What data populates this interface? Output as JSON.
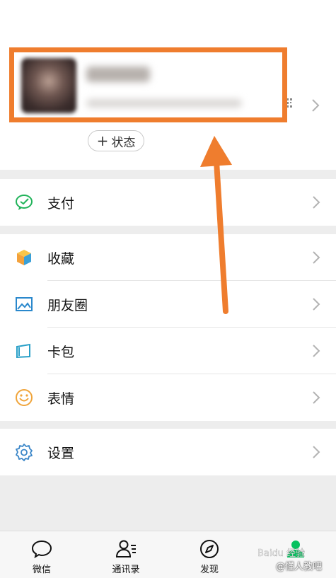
{
  "profile": {
    "status_plus": "+",
    "status_label": "状态"
  },
  "menu": {
    "pay": "支付",
    "favorites": "收藏",
    "moments": "朋友圈",
    "cards": "卡包",
    "stickers": "表情",
    "settings": "设置"
  },
  "tabbar": {
    "chats": "微信",
    "contacts": "通讯录",
    "discover": "发现",
    "active_tab": "me"
  },
  "watermark": {
    "text": "@懂人教吧"
  },
  "colors": {
    "highlight": "#ef7d2e",
    "wechat_green": "#07c160",
    "pay_green": "#21b35a",
    "favorites_orange": "#f3a13b",
    "moments_blue": "#2a88cc",
    "cards_blue": "#2aa0c8",
    "stickers_yellow": "#f0a43a",
    "settings_blue": "#3a86c8"
  },
  "icons": {
    "pay": "pay-icon",
    "favorites": "cube-icon",
    "moments": "image-icon",
    "cards": "wallet-icon",
    "stickers": "smiley-icon",
    "settings": "gear-icon",
    "chats": "chat-bubble-icon",
    "contacts": "contacts-icon",
    "discover": "compass-icon",
    "me": "person-icon"
  }
}
